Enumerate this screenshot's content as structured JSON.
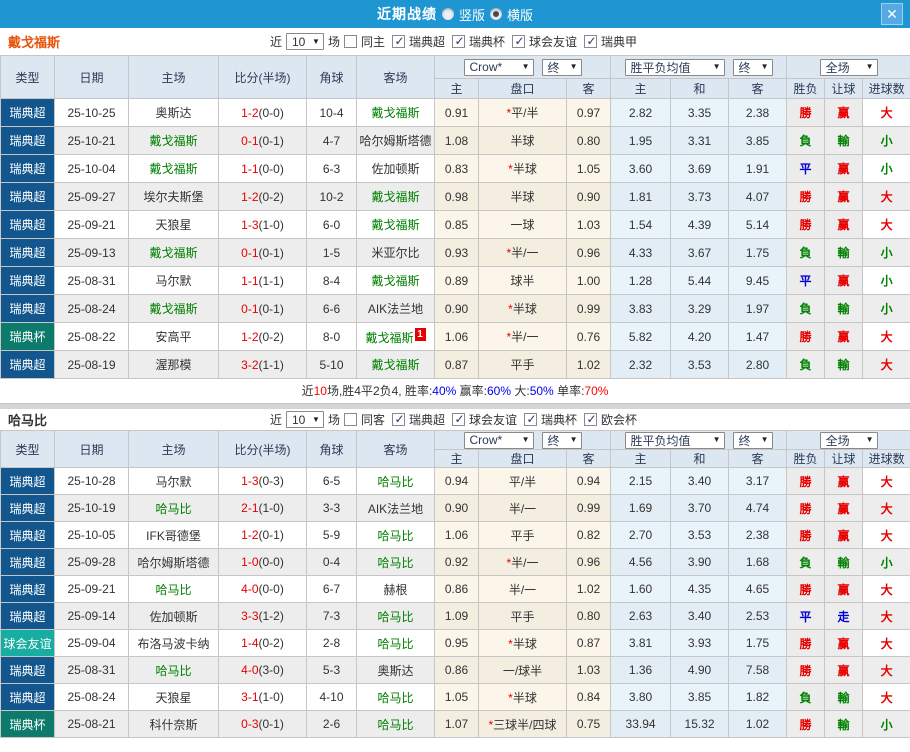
{
  "titlebar": {
    "title": "近期战绩",
    "vertical_label": "竖版",
    "horizontal_label": "横版",
    "vertical_checked": false,
    "horizontal_checked": true
  },
  "icons": {
    "dropdown": "▼",
    "close": "✕",
    "check": "✓"
  },
  "star_glyph": "*",
  "accent_colors": {
    "header_bar": "#1e96d2",
    "team_home": "#008000",
    "win": "#e60000",
    "lose": "#008000",
    "draw": "#0000d8"
  },
  "type_colors": {
    "瑞典超": "#12568d",
    "瑞典杯": "#0c7b6c",
    "球会友谊": "#17ada0",
    "瑞典甲": "#12568d",
    "欧会杯": "#0c7b6c"
  },
  "columns": {
    "type": "类型",
    "date": "日期",
    "home": "主场",
    "score": "比分(半场)",
    "corners": "角球",
    "away": "客场",
    "crow_home": "主",
    "pan": "盘口",
    "crow_away": "客",
    "avg_home": "主",
    "avg_draw": "和",
    "avg_away": "客",
    "wdl": "胜负",
    "rang": "让球",
    "goals": "进球数"
  },
  "header_selects": {
    "source": "Crow*",
    "final_a": "终",
    "avg": "胜平负均值",
    "final_b": "终",
    "scope": "全场"
  },
  "sections": [
    {
      "team": "戴戈福斯",
      "team_color": "#e8530a",
      "filter": {
        "prefix": "近",
        "count": "10",
        "suffix": "场",
        "same_label": "同主",
        "same_checked": false,
        "leagues": [
          "瑞典超",
          "瑞典杯",
          "球会友谊",
          "瑞典甲"
        ]
      },
      "rows": [
        {
          "type": "瑞典超",
          "date": "25-10-25",
          "home": "奥斯达",
          "home_team": false,
          "score": "1-2",
          "half": "(0-0)",
          "corners": "10-4",
          "away": "戴戈福斯",
          "away_team": true,
          "badge": "",
          "h": "0.91",
          "pan": "平/半",
          "pan_star": true,
          "a": "0.97",
          "m_h": "2.82",
          "m_d": "3.35",
          "m_a": "2.38",
          "wdl": "勝",
          "wdl_r": "win",
          "rang": "赢",
          "rang_r": "win",
          "da": "大",
          "da_r": "win"
        },
        {
          "type": "瑞典超",
          "date": "25-10-21",
          "home": "戴戈福斯",
          "home_team": true,
          "score": "0-1",
          "half": "(0-1)",
          "corners": "4-7",
          "away": "哈尔姆斯塔德",
          "away_team": false,
          "badge": "",
          "h": "1.08",
          "pan": "半球",
          "pan_star": false,
          "a": "0.80",
          "m_h": "1.95",
          "m_d": "3.31",
          "m_a": "3.85",
          "wdl": "負",
          "wdl_r": "lose",
          "rang": "輸",
          "rang_r": "lose",
          "da": "小",
          "da_r": "lose"
        },
        {
          "type": "瑞典超",
          "date": "25-10-04",
          "home": "戴戈福斯",
          "home_team": true,
          "score": "1-1",
          "half": "(0-0)",
          "corners": "6-3",
          "away": "佐加顿斯",
          "away_team": false,
          "badge": "",
          "h": "0.83",
          "pan": "半球",
          "pan_star": true,
          "a": "1.05",
          "m_h": "3.60",
          "m_d": "3.69",
          "m_a": "1.91",
          "wdl": "平",
          "wdl_r": "draw",
          "rang": "赢",
          "rang_r": "win",
          "da": "小",
          "da_r": "lose"
        },
        {
          "type": "瑞典超",
          "date": "25-09-27",
          "home": "埃尔夫斯堡",
          "home_team": false,
          "score": "1-2",
          "half": "(0-2)",
          "corners": "10-2",
          "away": "戴戈福斯",
          "away_team": true,
          "badge": "",
          "h": "0.98",
          "pan": "半球",
          "pan_star": false,
          "a": "0.90",
          "m_h": "1.81",
          "m_d": "3.73",
          "m_a": "4.07",
          "wdl": "勝",
          "wdl_r": "win",
          "rang": "赢",
          "rang_r": "win",
          "da": "大",
          "da_r": "win"
        },
        {
          "type": "瑞典超",
          "date": "25-09-21",
          "home": "天狼星",
          "home_team": false,
          "score": "1-3",
          "half": "(1-0)",
          "corners": "6-0",
          "away": "戴戈福斯",
          "away_team": true,
          "badge": "",
          "h": "0.85",
          "pan": "一球",
          "pan_star": false,
          "a": "1.03",
          "m_h": "1.54",
          "m_d": "4.39",
          "m_a": "5.14",
          "wdl": "勝",
          "wdl_r": "win",
          "rang": "赢",
          "rang_r": "win",
          "da": "大",
          "da_r": "win"
        },
        {
          "type": "瑞典超",
          "date": "25-09-13",
          "home": "戴戈福斯",
          "home_team": true,
          "score": "0-1",
          "half": "(0-1)",
          "corners": "1-5",
          "away": "米亚尔比",
          "away_team": false,
          "badge": "",
          "h": "0.93",
          "pan": "半/一",
          "pan_star": true,
          "a": "0.96",
          "m_h": "4.33",
          "m_d": "3.67",
          "m_a": "1.75",
          "wdl": "負",
          "wdl_r": "lose",
          "rang": "輸",
          "rang_r": "lose",
          "da": "小",
          "da_r": "lose"
        },
        {
          "type": "瑞典超",
          "date": "25-08-31",
          "home": "马尔默",
          "home_team": false,
          "score": "1-1",
          "half": "(1-1)",
          "corners": "8-4",
          "away": "戴戈福斯",
          "away_team": true,
          "badge": "",
          "h": "0.89",
          "pan": "球半",
          "pan_star": false,
          "a": "1.00",
          "m_h": "1.28",
          "m_d": "5.44",
          "m_a": "9.45",
          "wdl": "平",
          "wdl_r": "draw",
          "rang": "赢",
          "rang_r": "win",
          "da": "小",
          "da_r": "lose"
        },
        {
          "type": "瑞典超",
          "date": "25-08-24",
          "home": "戴戈福斯",
          "home_team": true,
          "score": "0-1",
          "half": "(0-1)",
          "corners": "6-6",
          "away": "AIK法兰地",
          "away_team": false,
          "badge": "",
          "h": "0.90",
          "pan": "半球",
          "pan_star": true,
          "a": "0.99",
          "m_h": "3.83",
          "m_d": "3.29",
          "m_a": "1.97",
          "wdl": "負",
          "wdl_r": "lose",
          "rang": "輸",
          "rang_r": "lose",
          "da": "小",
          "da_r": "lose"
        },
        {
          "type": "瑞典杯",
          "date": "25-08-22",
          "home": "安高平",
          "home_team": false,
          "score": "1-2",
          "half": "(0-2)",
          "corners": "8-0",
          "away": "戴戈福斯",
          "away_team": true,
          "badge": "1",
          "h": "1.06",
          "pan": "半/一",
          "pan_star": true,
          "a": "0.76",
          "m_h": "5.82",
          "m_d": "4.20",
          "m_a": "1.47",
          "wdl": "勝",
          "wdl_r": "win",
          "rang": "赢",
          "rang_r": "win",
          "da": "大",
          "da_r": "win"
        },
        {
          "type": "瑞典超",
          "date": "25-08-19",
          "home": "渥那模",
          "home_team": false,
          "score": "3-2",
          "half": "(1-1)",
          "corners": "5-10",
          "away": "戴戈福斯",
          "away_team": true,
          "badge": "",
          "h": "0.87",
          "pan": "平手",
          "pan_star": false,
          "a": "1.02",
          "m_h": "2.32",
          "m_d": "3.53",
          "m_a": "2.80",
          "wdl": "負",
          "wdl_r": "lose",
          "rang": "輸",
          "rang_r": "lose",
          "da": "大",
          "da_r": "win"
        }
      ],
      "summary": [
        {
          "t": "近",
          "c": "d"
        },
        {
          "t": "10",
          "c": "r"
        },
        {
          "t": "场,胜4平2负4, 胜率:",
          "c": "d"
        },
        {
          "t": "40%",
          "c": "b"
        },
        {
          "t": " 赢率:",
          "c": "d"
        },
        {
          "t": "60%",
          "c": "b"
        },
        {
          "t": " 大:",
          "c": "d"
        },
        {
          "t": "50%",
          "c": "b"
        },
        {
          "t": " 单率:",
          "c": "d"
        },
        {
          "t": "70%",
          "c": "r"
        }
      ]
    },
    {
      "team": "哈马比",
      "team_color": "#333333",
      "filter": {
        "prefix": "近",
        "count": "10",
        "suffix": "场",
        "same_label": "同客",
        "same_checked": false,
        "leagues": [
          "瑞典超",
          "球会友谊",
          "瑞典杯",
          "欧会杯"
        ]
      },
      "rows": [
        {
          "type": "瑞典超",
          "date": "25-10-28",
          "home": "马尔默",
          "home_team": false,
          "score": "1-3",
          "half": "(0-3)",
          "corners": "6-5",
          "away": "哈马比",
          "away_team": true,
          "badge": "",
          "h": "0.94",
          "pan": "平/半",
          "pan_star": false,
          "a": "0.94",
          "m_h": "2.15",
          "m_d": "3.40",
          "m_a": "3.17",
          "wdl": "勝",
          "wdl_r": "win",
          "rang": "赢",
          "rang_r": "win",
          "da": "大",
          "da_r": "win"
        },
        {
          "type": "瑞典超",
          "date": "25-10-19",
          "home": "哈马比",
          "home_team": true,
          "score": "2-1",
          "half": "(1-0)",
          "corners": "3-3",
          "away": "AIK法兰地",
          "away_team": false,
          "badge": "",
          "h": "0.90",
          "pan": "半/一",
          "pan_star": false,
          "a": "0.99",
          "m_h": "1.69",
          "m_d": "3.70",
          "m_a": "4.74",
          "wdl": "勝",
          "wdl_r": "win",
          "rang": "赢",
          "rang_r": "win",
          "da": "大",
          "da_r": "win"
        },
        {
          "type": "瑞典超",
          "date": "25-10-05",
          "home": "IFK哥德堡",
          "home_team": false,
          "score": "1-2",
          "half": "(0-1)",
          "corners": "5-9",
          "away": "哈马比",
          "away_team": true,
          "badge": "",
          "h": "1.06",
          "pan": "平手",
          "pan_star": false,
          "a": "0.82",
          "m_h": "2.70",
          "m_d": "3.53",
          "m_a": "2.38",
          "wdl": "勝",
          "wdl_r": "win",
          "rang": "赢",
          "rang_r": "win",
          "da": "大",
          "da_r": "win"
        },
        {
          "type": "瑞典超",
          "date": "25-09-28",
          "home": "哈尔姆斯塔德",
          "home_team": false,
          "score": "1-0",
          "half": "(0-0)",
          "corners": "0-4",
          "away": "哈马比",
          "away_team": true,
          "badge": "",
          "h": "0.92",
          "pan": "半/一",
          "pan_star": true,
          "a": "0.96",
          "m_h": "4.56",
          "m_d": "3.90",
          "m_a": "1.68",
          "wdl": "負",
          "wdl_r": "lose",
          "rang": "輸",
          "rang_r": "lose",
          "da": "小",
          "da_r": "lose"
        },
        {
          "type": "瑞典超",
          "date": "25-09-21",
          "home": "哈马比",
          "home_team": true,
          "score": "4-0",
          "half": "(0-0)",
          "corners": "6-7",
          "away": "赫根",
          "away_team": false,
          "badge": "",
          "h": "0.86",
          "pan": "半/一",
          "pan_star": false,
          "a": "1.02",
          "m_h": "1.60",
          "m_d": "4.35",
          "m_a": "4.65",
          "wdl": "勝",
          "wdl_r": "win",
          "rang": "赢",
          "rang_r": "win",
          "da": "大",
          "da_r": "win"
        },
        {
          "type": "瑞典超",
          "date": "25-09-14",
          "home": "佐加顿斯",
          "home_team": false,
          "score": "3-3",
          "half": "(1-2)",
          "corners": "7-3",
          "away": "哈马比",
          "away_team": true,
          "badge": "",
          "h": "1.09",
          "pan": "平手",
          "pan_star": false,
          "a": "0.80",
          "m_h": "2.63",
          "m_d": "3.40",
          "m_a": "2.53",
          "wdl": "平",
          "wdl_r": "draw",
          "rang": "走",
          "rang_r": "draw",
          "da": "大",
          "da_r": "win"
        },
        {
          "type": "球会友谊",
          "date": "25-09-04",
          "home": "布洛马波卡纳",
          "home_team": false,
          "score": "1-4",
          "half": "(0-2)",
          "corners": "2-8",
          "away": "哈马比",
          "away_team": true,
          "badge": "",
          "h": "0.95",
          "pan": "半球",
          "pan_star": true,
          "a": "0.87",
          "m_h": "3.81",
          "m_d": "3.93",
          "m_a": "1.75",
          "wdl": "勝",
          "wdl_r": "win",
          "rang": "赢",
          "rang_r": "win",
          "da": "大",
          "da_r": "win"
        },
        {
          "type": "瑞典超",
          "date": "25-08-31",
          "home": "哈马比",
          "home_team": true,
          "score": "4-0",
          "half": "(3-0)",
          "corners": "5-3",
          "away": "奥斯达",
          "away_team": false,
          "badge": "",
          "h": "0.86",
          "pan": "一/球半",
          "pan_star": false,
          "a": "1.03",
          "m_h": "1.36",
          "m_d": "4.90",
          "m_a": "7.58",
          "wdl": "勝",
          "wdl_r": "win",
          "rang": "赢",
          "rang_r": "win",
          "da": "大",
          "da_r": "win"
        },
        {
          "type": "瑞典超",
          "date": "25-08-24",
          "home": "天狼星",
          "home_team": false,
          "score": "3-1",
          "half": "(1-0)",
          "corners": "4-10",
          "away": "哈马比",
          "away_team": true,
          "badge": "",
          "h": "1.05",
          "pan": "半球",
          "pan_star": true,
          "a": "0.84",
          "m_h": "3.80",
          "m_d": "3.85",
          "m_a": "1.82",
          "wdl": "負",
          "wdl_r": "lose",
          "rang": "輸",
          "rang_r": "lose",
          "da": "大",
          "da_r": "win"
        },
        {
          "type": "瑞典杯",
          "date": "25-08-21",
          "home": "科什奈斯",
          "home_team": false,
          "score": "0-3",
          "half": "(0-1)",
          "corners": "2-6",
          "away": "哈马比",
          "away_team": true,
          "badge": "",
          "h": "1.07",
          "pan": "三球半/四球",
          "pan_star": true,
          "a": "0.75",
          "m_h": "33.94",
          "m_d": "15.32",
          "m_a": "1.02",
          "wdl": "勝",
          "wdl_r": "win",
          "rang": "輸",
          "rang_r": "lose",
          "da": "小",
          "da_r": "lose"
        }
      ],
      "summary": []
    }
  ]
}
